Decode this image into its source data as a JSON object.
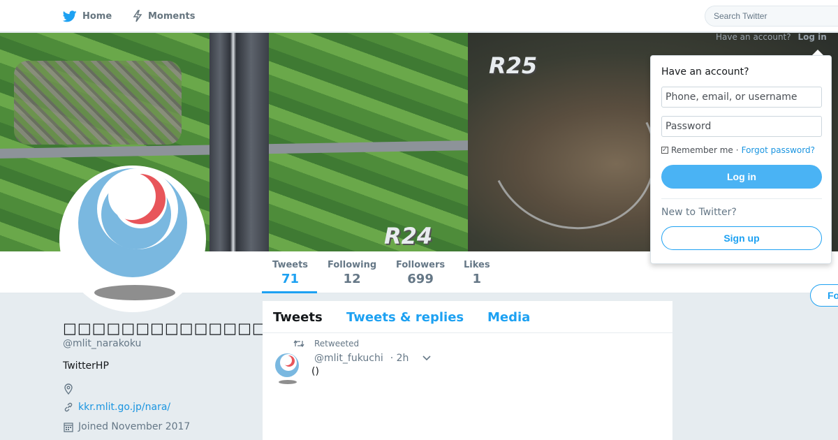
{
  "nav": {
    "home_label": "Home",
    "moments_label": "Moments",
    "search_placeholder": "Search Twitter"
  },
  "banner": {
    "label_left": "R24",
    "label_right": "R25",
    "have_account_text": "Have an account?",
    "login_link": "Log in"
  },
  "profile": {
    "name": "□□□□□□□□□□□□□□",
    "handle": "@mlit_narakoku",
    "bio": "TwitterHP",
    "location": "",
    "url": "kkr.mlit.go.jp/nara/",
    "joined": "Joined November 2017"
  },
  "stats": {
    "tweets_label": "Tweets",
    "tweets_value": "71",
    "following_label": "Following",
    "following_value": "12",
    "followers_label": "Followers",
    "followers_value": "699",
    "likes_label": "Likes",
    "likes_value": "1"
  },
  "follow_button": "Fo",
  "timeline": {
    "tabs": [
      {
        "label": "Tweets",
        "active": true
      },
      {
        "label": "Tweets & replies",
        "active": false
      },
      {
        "label": "Media",
        "active": false
      }
    ],
    "tweet": {
      "retweet_label": "Retweeted",
      "handle": "@mlit_fukuchi",
      "time": "· 2h",
      "text": "()"
    }
  },
  "login": {
    "title": "Have an account?",
    "username_placeholder": "Phone, email, or username",
    "password_placeholder": "Password",
    "remember_label": "Remember me",
    "separator": "·",
    "forgot_link": "Forgot password?",
    "login_button": "Log in",
    "new_label": "New to Twitter?",
    "signup_button": "Sign up"
  },
  "colors": {
    "accent": "#1da1f2",
    "login_button_bg": "#4ab3f4",
    "logo_blue": "#7ab8e0",
    "logo_red": "#e8555a"
  }
}
